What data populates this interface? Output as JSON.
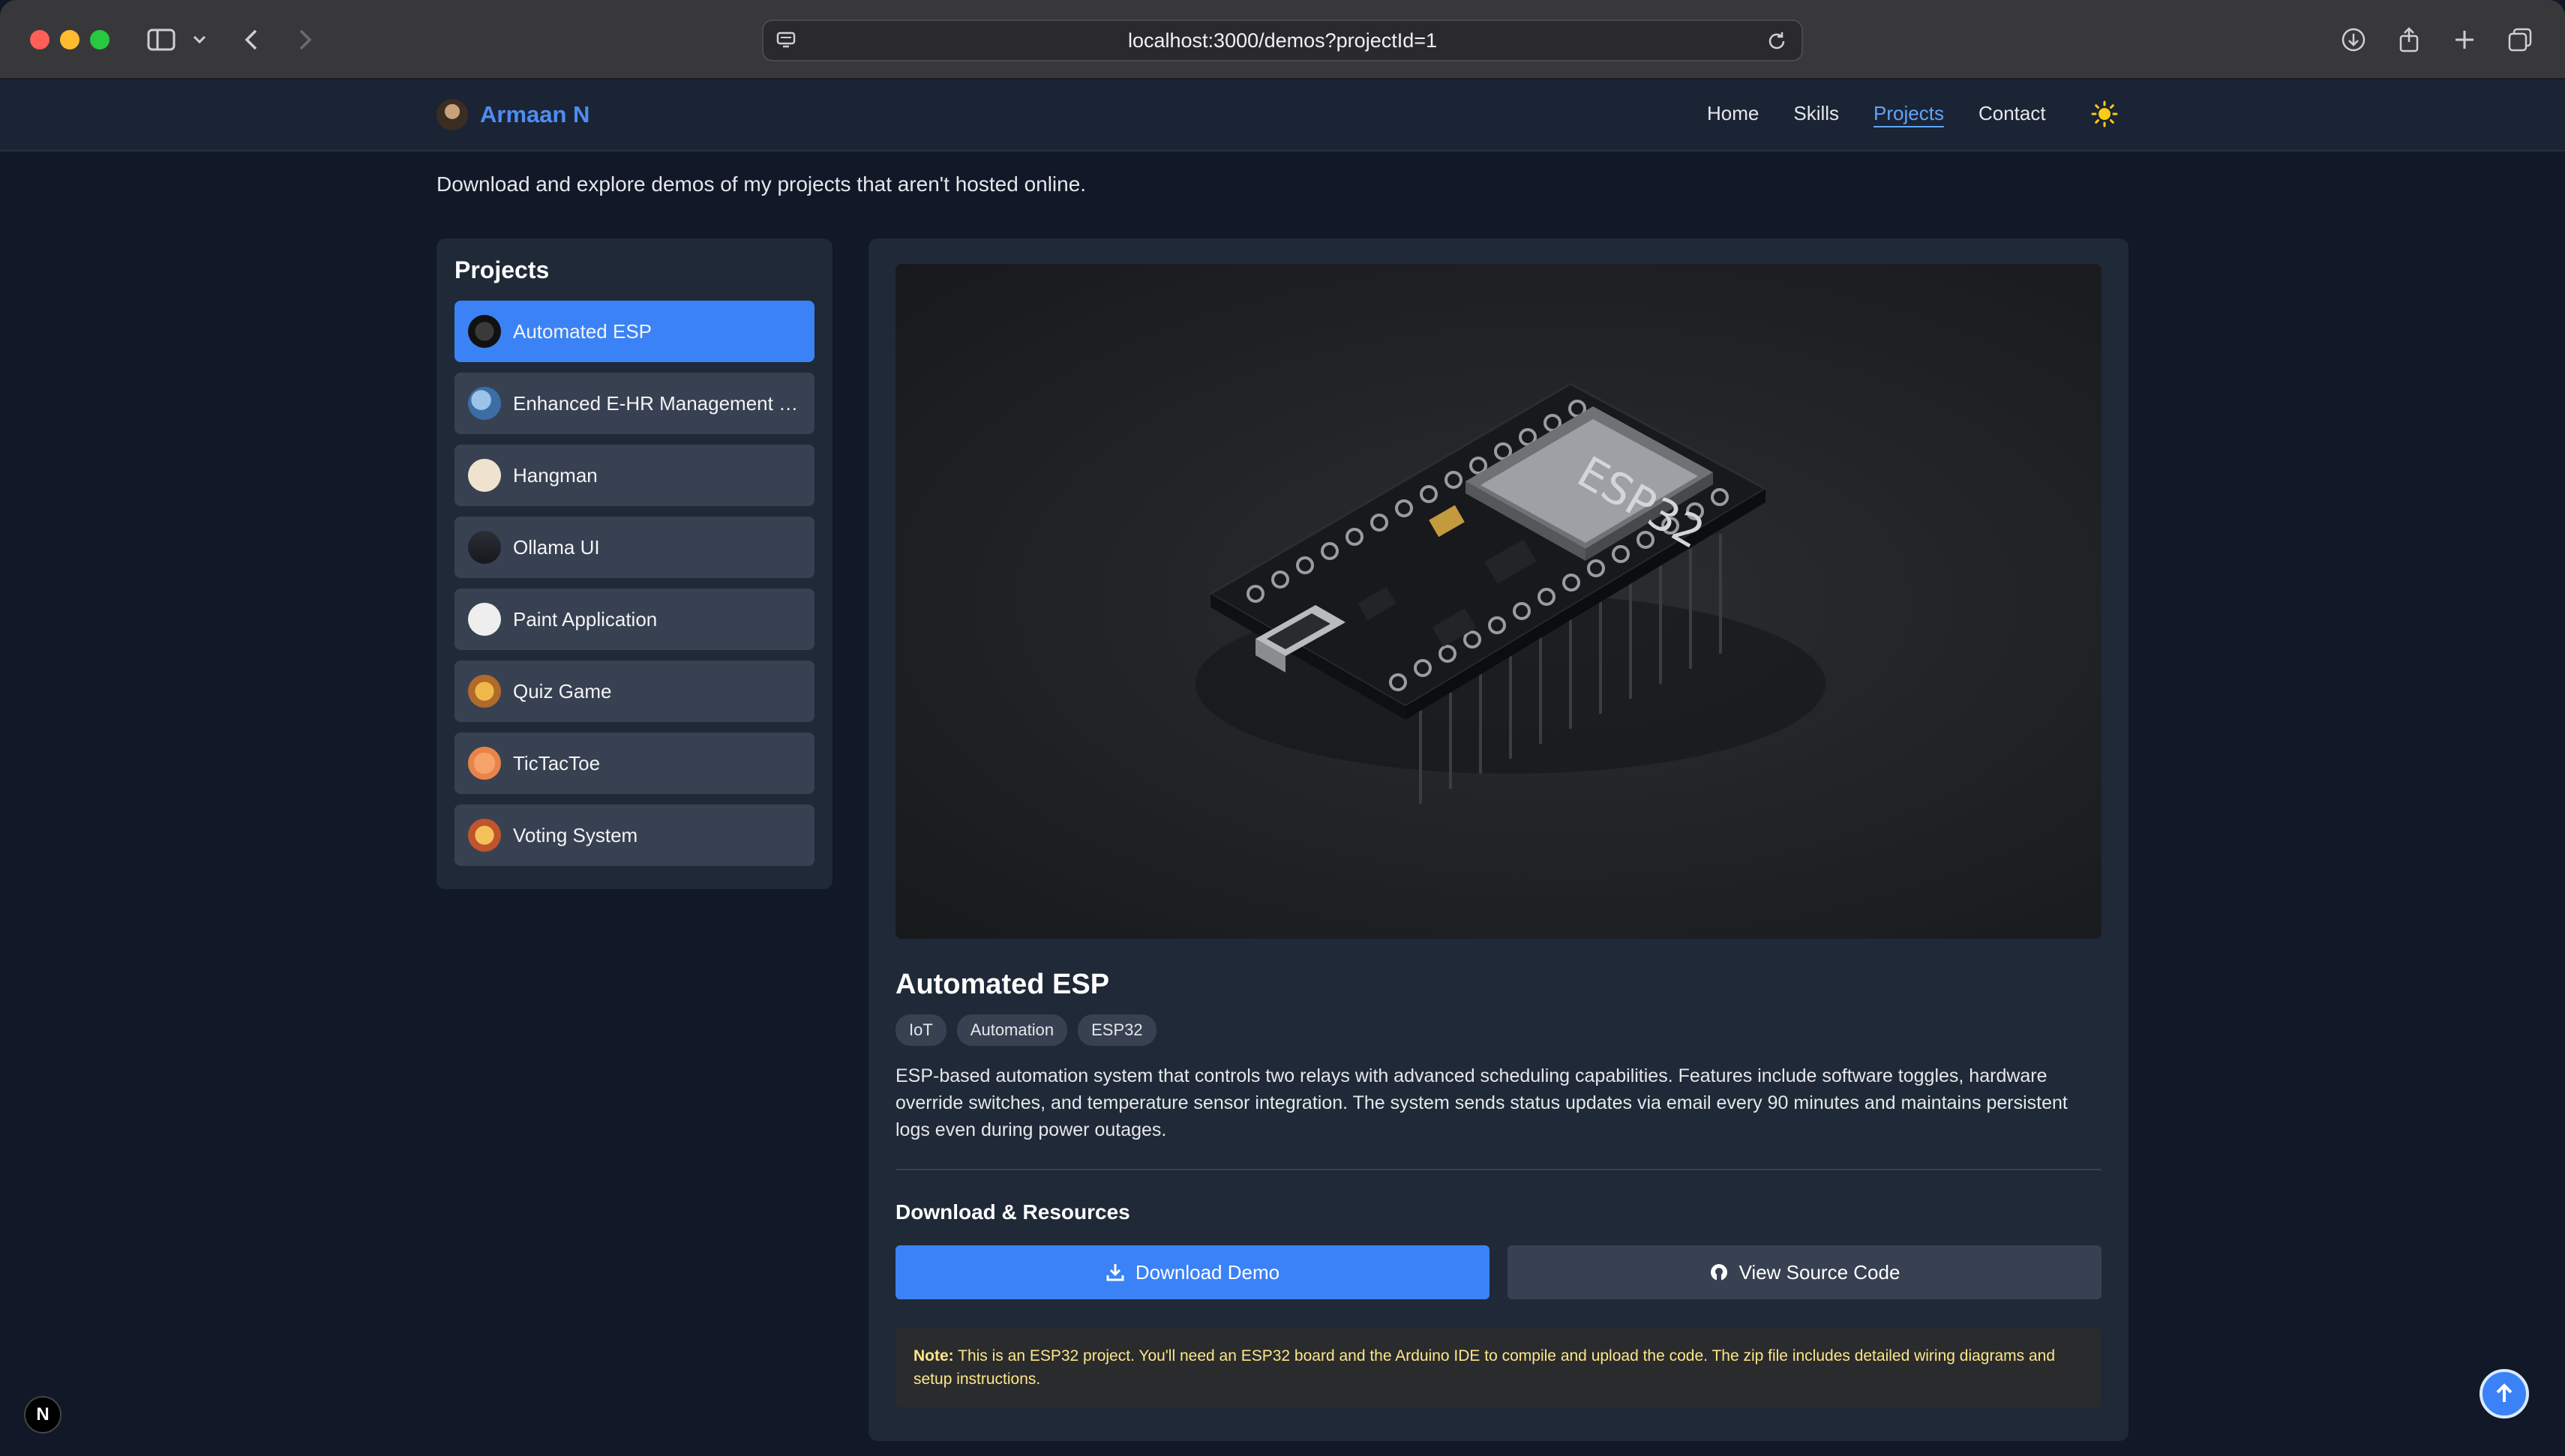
{
  "browser": {
    "url": "localhost:3000/demos?projectId=1",
    "icons": [
      "sidebar-toggle-icon",
      "chevron-down-icon",
      "back-icon",
      "forward-icon",
      "page-icon",
      "reload-icon",
      "download-icon",
      "share-icon",
      "new-tab-icon",
      "tabs-overview-icon"
    ]
  },
  "nav": {
    "brand": "Armaan N",
    "links": [
      "Home",
      "Skills",
      "Projects",
      "Contact"
    ],
    "active_link": "Projects",
    "theme_icon": "sun-icon"
  },
  "intro": "Download and explore demos of my projects that aren't hosted online.",
  "sidebar": {
    "title": "Projects",
    "items": [
      {
        "label": "Automated ESP",
        "active": true
      },
      {
        "label": "Enhanced E-HR Management S..."
      },
      {
        "label": "Hangman"
      },
      {
        "label": "Ollama UI"
      },
      {
        "label": "Paint Application"
      },
      {
        "label": "Quiz Game"
      },
      {
        "label": "TicTacToe"
      },
      {
        "label": "Voting System"
      }
    ]
  },
  "project": {
    "chip_text": "ESP32",
    "title": "Automated ESP",
    "tags": [
      "IoT",
      "Automation",
      "ESP32"
    ],
    "description": "ESP-based automation system that controls two relays with advanced scheduling capabilities. Features include software toggles, hardware override switches, and temperature sensor integration. The system sends status updates via email every 90 minutes and maintains persistent logs even during power outages.",
    "resources_title": "Download & Resources",
    "download_label": "Download Demo",
    "source_label": "View Source Code",
    "note_label": "Note:",
    "note_text": " This is an ESP32 project. You'll need an ESP32 board and the Arduino IDE to compile and upload the code. The zip file includes detailed wiring diagrams and setup instructions."
  },
  "overlay": {
    "dev_badge": "N"
  },
  "colors": {
    "accent": "#3b82f6",
    "background": "#111827",
    "panel": "#1f2937",
    "note_text": "#fde68a"
  }
}
